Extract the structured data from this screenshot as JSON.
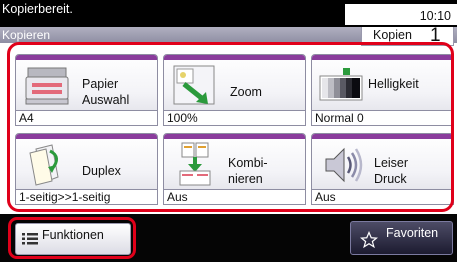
{
  "status": {
    "message": "Kopierbereit.",
    "time": "10:10"
  },
  "subbar": {
    "title": "Kopieren",
    "copies_label": "Kopien",
    "copies_count": "1"
  },
  "tiles": [
    {
      "label_line1": "Papier",
      "label_line2": "Auswahl",
      "value": "A4",
      "icon": "paper-tray-icon"
    },
    {
      "label_line1": "Zoom",
      "label_line2": "",
      "value": "100%",
      "icon": "zoom-icon"
    },
    {
      "label_line1": "Helligkeit",
      "label_line2": "",
      "value": "Normal 0",
      "icon": "brightness-icon"
    },
    {
      "label_line1": "Duplex",
      "label_line2": "",
      "value": "1-seitig>>1-seitig",
      "icon": "duplex-icon"
    },
    {
      "label_line1": "Kombi-",
      "label_line2": "nieren",
      "value": "Aus",
      "icon": "combine-icon"
    },
    {
      "label_line1": "Leiser",
      "label_line2": "Druck",
      "value": "Aus",
      "icon": "quiet-mode-icon"
    }
  ],
  "bottom": {
    "functions_label": "Funktionen",
    "favorites_label": "Favoriten"
  },
  "colors": {
    "accent_frame": "#e0001a",
    "tile_stripe": "#8a3c9c"
  }
}
